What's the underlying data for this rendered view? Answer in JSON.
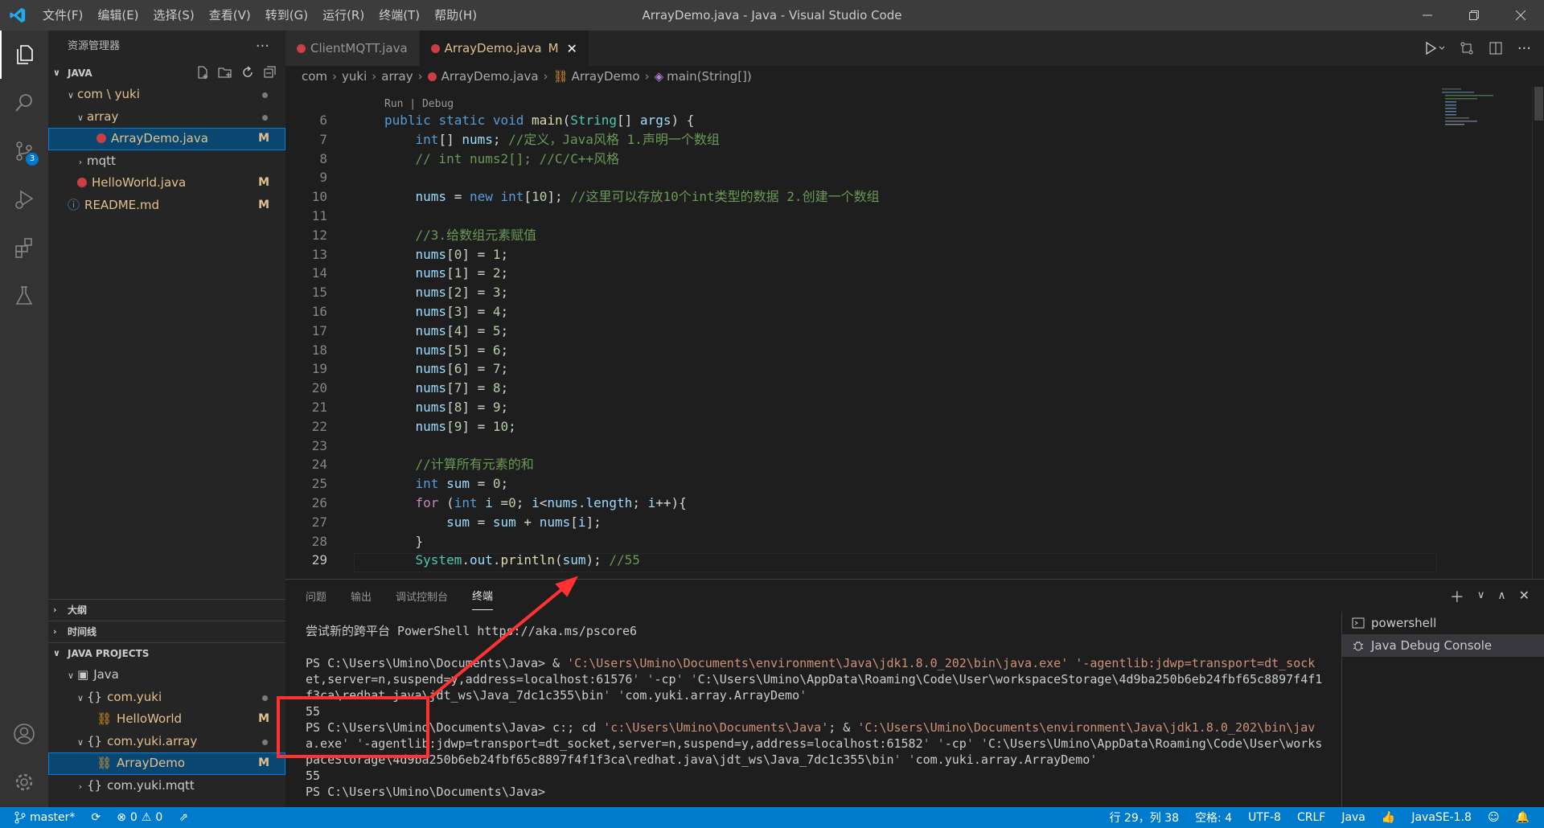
{
  "window": {
    "title": "ArrayDemo.java - Java - Visual Studio Code",
    "menu": [
      "文件(F)",
      "编辑(E)",
      "选择(S)",
      "查看(V)",
      "转到(G)",
      "运行(R)",
      "终端(T)",
      "帮助(H)"
    ]
  },
  "activity_bar": {
    "icons": [
      "explorer-icon",
      "search-icon",
      "source-control-icon",
      "run-debug-icon",
      "extensions-icon",
      "testing-icon",
      "account-icon",
      "settings-gear-icon"
    ],
    "scm_badge": "3"
  },
  "sidebar": {
    "header": "资源管理器",
    "workspace": "JAVA",
    "tree": [
      {
        "label": "com \\ yuki",
        "depth": 1,
        "kind": "folder-open",
        "status": "dot"
      },
      {
        "label": "array",
        "depth": 2,
        "kind": "folder-open",
        "status": "dot"
      },
      {
        "label": "ArrayDemo.java",
        "depth": 3,
        "kind": "java",
        "status": "M",
        "selected": true
      },
      {
        "label": "mqtt",
        "depth": 2,
        "kind": "folder-closed",
        "status": ""
      },
      {
        "label": "HelloWorld.java",
        "depth": 1,
        "kind": "java",
        "status": "M"
      },
      {
        "label": "README.md",
        "depth": 0,
        "kind": "info",
        "status": "M"
      }
    ],
    "sections": {
      "outline": "大纲",
      "timeline": "时间线",
      "java_projects": "JAVA PROJECTS"
    },
    "projects": [
      {
        "label": "Java",
        "depth": 1,
        "kind": "project",
        "status": ""
      },
      {
        "label": "com.yuki",
        "depth": 2,
        "kind": "package",
        "status": "dot"
      },
      {
        "label": "HelloWorld",
        "depth": 3,
        "kind": "class",
        "status": "M"
      },
      {
        "label": "com.yuki.array",
        "depth": 2,
        "kind": "package",
        "status": "dot"
      },
      {
        "label": "ArrayDemo",
        "depth": 3,
        "kind": "class",
        "status": "M",
        "selected": true
      },
      {
        "label": "com.yuki.mqtt",
        "depth": 2,
        "kind": "package-closed",
        "status": ""
      }
    ]
  },
  "tabs": [
    {
      "label": "ClientMQTT.java",
      "active": false,
      "marker": ""
    },
    {
      "label": "ArrayDemo.java",
      "active": true,
      "marker": "M"
    }
  ],
  "breadcrumb": [
    "com",
    "yuki",
    "array",
    "ArrayDemo.java",
    "ArrayDemo",
    "main(String[])"
  ],
  "codelens": "Run | Debug",
  "code_lines": [
    {
      "n": "6",
      "html": "<span class='kw'>public</span> <span class='kw'>static</span> <span class='kw'>void</span> <span class='fn'>main</span><span class='pl'>(</span><span class='ty'>String</span><span class='pl'>[] </span><span class='vr'>args</span><span class='pl'>) {</span>"
    },
    {
      "n": "7",
      "html": "    <span class='kw'>int</span><span class='pl'>[] </span><span class='vr'>nums</span><span class='pl'>; </span><span class='cm'>//定义，Java风格 1.声明一个数组</span>"
    },
    {
      "n": "8",
      "html": "    <span class='cm'>// int nums2[]; //C/C++风格</span>"
    },
    {
      "n": "9",
      "html": ""
    },
    {
      "n": "10",
      "html": "    <span class='vr'>nums</span><span class='pl'> = </span><span class='kw'>new</span> <span class='kw'>int</span><span class='pl'>[</span><span class='nm'>10</span><span class='pl'>]; </span><span class='cm'>//这里可以存放10个int类型的数据 2.创建一个数组</span>"
    },
    {
      "n": "11",
      "html": ""
    },
    {
      "n": "12",
      "html": "    <span class='cm'>//3.给数组元素赋值</span>"
    },
    {
      "n": "13",
      "html": "    <span class='vr'>nums</span><span class='pl'>[</span><span class='nm'>0</span><span class='pl'>] = </span><span class='nm'>1</span><span class='pl'>;</span>"
    },
    {
      "n": "14",
      "html": "    <span class='vr'>nums</span><span class='pl'>[</span><span class='nm'>1</span><span class='pl'>] = </span><span class='nm'>2</span><span class='pl'>;</span>"
    },
    {
      "n": "15",
      "html": "    <span class='vr'>nums</span><span class='pl'>[</span><span class='nm'>2</span><span class='pl'>] = </span><span class='nm'>3</span><span class='pl'>;</span>"
    },
    {
      "n": "16",
      "html": "    <span class='vr'>nums</span><span class='pl'>[</span><span class='nm'>3</span><span class='pl'>] = </span><span class='nm'>4</span><span class='pl'>;</span>"
    },
    {
      "n": "17",
      "html": "    <span class='vr'>nums</span><span class='pl'>[</span><span class='nm'>4</span><span class='pl'>] = </span><span class='nm'>5</span><span class='pl'>;</span>"
    },
    {
      "n": "18",
      "html": "    <span class='vr'>nums</span><span class='pl'>[</span><span class='nm'>5</span><span class='pl'>] = </span><span class='nm'>6</span><span class='pl'>;</span>"
    },
    {
      "n": "19",
      "html": "    <span class='vr'>nums</span><span class='pl'>[</span><span class='nm'>6</span><span class='pl'>] = </span><span class='nm'>7</span><span class='pl'>;</span>"
    },
    {
      "n": "20",
      "html": "    <span class='vr'>nums</span><span class='pl'>[</span><span class='nm'>7</span><span class='pl'>] = </span><span class='nm'>8</span><span class='pl'>;</span>"
    },
    {
      "n": "21",
      "html": "    <span class='vr'>nums</span><span class='pl'>[</span><span class='nm'>8</span><span class='pl'>] = </span><span class='nm'>9</span><span class='pl'>;</span>"
    },
    {
      "n": "22",
      "html": "    <span class='vr'>nums</span><span class='pl'>[</span><span class='nm'>9</span><span class='pl'>] = </span><span class='nm'>10</span><span class='pl'>;</span>"
    },
    {
      "n": "23",
      "html": ""
    },
    {
      "n": "24",
      "html": "    <span class='cm'>//计算所有元素的和</span>"
    },
    {
      "n": "25",
      "html": "    <span class='kw'>int</span> <span class='vr'>sum</span><span class='pl'> = </span><span class='nm'>0</span><span class='pl'>;</span>"
    },
    {
      "n": "26",
      "html": "    <span class='ctl'>for</span><span class='pl'> (</span><span class='kw'>int</span> <span class='vr'>i</span><span class='pl'> =</span><span class='nm'>0</span><span class='pl'>; </span><span class='vr'>i</span><span class='pl'>&lt;</span><span class='vr'>nums</span><span class='pl'>.</span><span class='vr'>length</span><span class='pl'>; </span><span class='vr'>i</span><span class='pl'>++){</span>"
    },
    {
      "n": "27",
      "html": "        <span class='vr'>sum</span><span class='pl'> = </span><span class='vr'>sum</span><span class='pl'> + </span><span class='vr'>nums</span><span class='pl'>[</span><span class='vr'>i</span><span class='pl'>];</span>"
    },
    {
      "n": "28",
      "html": "    <span class='pl'>}</span>"
    },
    {
      "n": "29",
      "html": "    <span class='ty'>System</span><span class='pl'>.</span><span class='vr'>out</span><span class='pl'>.</span><span class='fn'>println</span><span class='pl'>(</span><span class='vr'>sum</span><span class='pl'>); </span><span class='cm'>//55</span>"
    }
  ],
  "panel": {
    "tabs": [
      "问题",
      "输出",
      "调试控制台",
      "终端"
    ],
    "active_tab": "终端",
    "terminal_lines": [
      "尝试新的跨平台 PowerShell https://aka.ms/pscore6",
      "",
      "PS C:\\Users\\Umino\\Documents\\Java>  & 'C:\\Users\\Umino\\Documents\\environment\\Java\\jdk1.8.0_202\\bin\\java.exe' '-agentlib:jdwp=transport=dt_sock",
      "et,server=n,suspend=y,address=localhost:61576' '-cp' 'C:\\Users\\Umino\\AppData\\Roaming\\Code\\User\\workspaceStorage\\4d9ba250b6eb24fbf65c8897f4f1",
      "f3ca\\redhat.java\\jdt_ws\\Java_7dc1c355\\bin' 'com.yuki.array.ArrayDemo'",
      "55",
      "PS C:\\Users\\Umino\\Documents\\Java>  c:; cd 'c:\\Users\\Umino\\Documents\\Java'; & 'C:\\Users\\Umino\\Documents\\environment\\Java\\jdk1.8.0_202\\bin\\jav",
      "a.exe' '-agentlib:jdwp=transport=dt_socket,server=n,suspend=y,address=localhost:61582' '-cp' 'C:\\Users\\Umino\\AppData\\Roaming\\Code\\User\\works",
      "paceStorage\\4d9ba250b6eb24fbf65c8897f4f1f3ca\\redhat.java\\jdt_ws\\Java_7dc1c355\\bin' 'com.yuki.array.ArrayDemo'",
      "55",
      "PS C:\\Users\\Umino\\Documents\\Java>"
    ],
    "terminals": [
      "powershell",
      "Java Debug Console"
    ]
  },
  "status_bar": {
    "branch": "master*",
    "errors": "0",
    "warnings": "0",
    "position": "行 29，列 38",
    "indent": "空格: 4",
    "encoding": "UTF-8",
    "eol": "CRLF",
    "language": "Java",
    "java_version": "JavaSE-1.8"
  },
  "colors": {
    "accent": "#007acc",
    "annotation": "#ff3131",
    "modified": "#e2c08d"
  }
}
